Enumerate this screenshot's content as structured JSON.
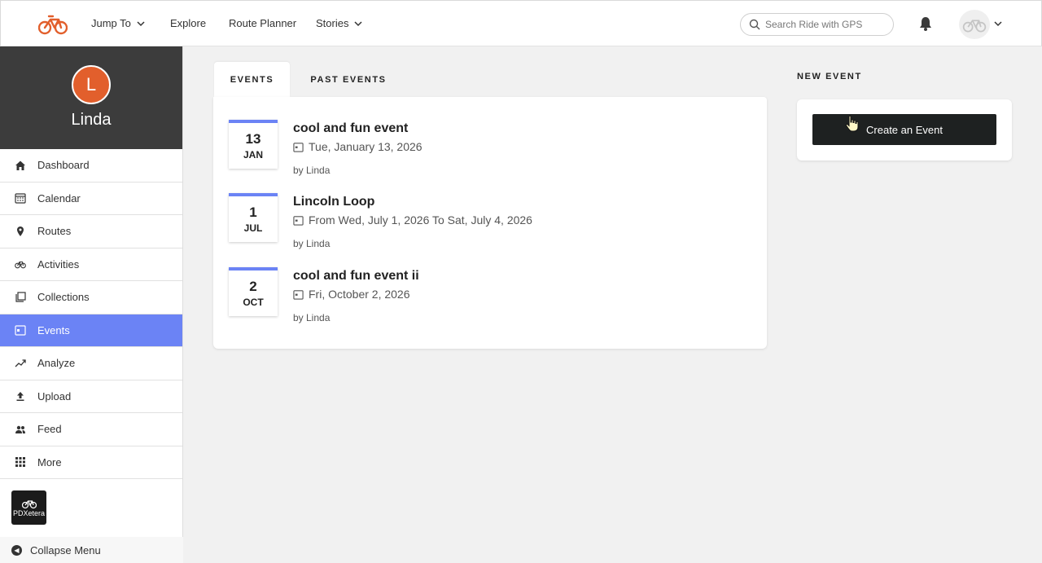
{
  "nav": {
    "jump_to": "Jump To",
    "explore": "Explore",
    "route_planner": "Route Planner",
    "stories": "Stories",
    "search_placeholder": "Search Ride with GPS"
  },
  "profile": {
    "initial": "L",
    "name": "Linda"
  },
  "sidebar": {
    "items": [
      {
        "label": "Dashboard"
      },
      {
        "label": "Calendar"
      },
      {
        "label": "Routes"
      },
      {
        "label": "Activities"
      },
      {
        "label": "Collections"
      },
      {
        "label": "Events"
      },
      {
        "label": "Analyze"
      },
      {
        "label": "Upload"
      },
      {
        "label": "Feed"
      },
      {
        "label": "More"
      }
    ],
    "club_label": "PDXetera",
    "collapse": "Collapse Menu"
  },
  "tabs": {
    "events": "EVENTS",
    "past_events": "PAST EVENTS"
  },
  "events": [
    {
      "day": "13",
      "month": "JAN",
      "title": "cool and fun event",
      "date": "Tue, January 13, 2026",
      "by": "by Linda"
    },
    {
      "day": "1",
      "month": "JUL",
      "title": "Lincoln Loop",
      "date": "From Wed, July 1, 2026 To Sat, July 4, 2026",
      "by": "by Linda"
    },
    {
      "day": "2",
      "month": "OCT",
      "title": "cool and fun event ii",
      "date": "Fri, October 2, 2026",
      "by": "by Linda"
    }
  ],
  "new_event": {
    "label": "NEW EVENT",
    "button": "Create an Event"
  },
  "colors": {
    "brand_orange": "#e25f2c",
    "accent_blue": "#6b83f5",
    "button_dark": "#1e2121"
  }
}
